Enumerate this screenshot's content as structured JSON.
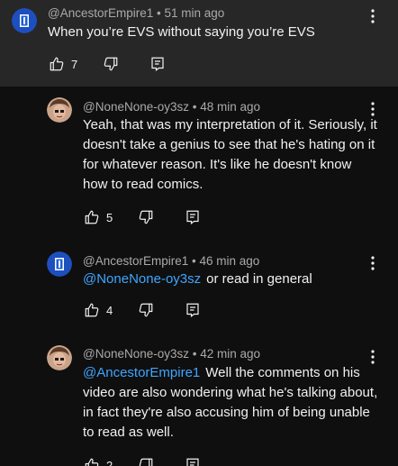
{
  "comments": [
    {
      "author": "@AncestorEmpire1",
      "meta_sep": " • ",
      "time": "51 min ago",
      "mention": "",
      "text": "When you’re EVS without saying you’re EVS",
      "likes": "7",
      "avatar_icon": "blue-flag-avatar-icon"
    },
    {
      "author": "@NoneNone-oy3sz",
      "meta_sep": " • ",
      "time": "48 min ago",
      "mention": "",
      "text": "Yeah, that was my interpretation of it. Seriously, it doesn't take a genius to see that he's hating on it for whatever reason. It's like he doesn't know how to read comics.",
      "likes": "5",
      "avatar_icon": "face-avatar-icon"
    },
    {
      "author": "@AncestorEmpire1",
      "meta_sep": " • ",
      "time": "46 min ago",
      "mention": "@NoneNone-oy3sz",
      "text": "or read in general",
      "likes": "4",
      "avatar_icon": "blue-flag-avatar-icon"
    },
    {
      "author": "@NoneNone-oy3sz",
      "meta_sep": " • ",
      "time": "42 min ago",
      "mention": "@AncestorEmpire1",
      "text": "Well the comments on his video are also wondering what he's talking about, in fact they're also accusing him of being unable to read as well.",
      "likes": "2",
      "avatar_icon": "face-avatar-icon"
    }
  ],
  "colors": {
    "background": "#0f0f0f",
    "highlight_background": "#272727",
    "mention": "#3ea6ff",
    "meta_text": "#aaaaaa"
  }
}
